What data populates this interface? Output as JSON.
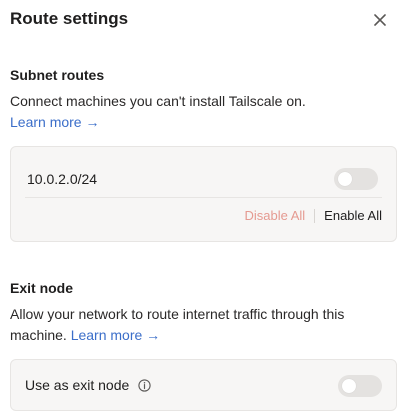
{
  "header": {
    "title": "Route settings",
    "close_icon": "close-icon"
  },
  "subnet": {
    "title": "Subnet routes",
    "description": "Connect machines you can't install Tailscale on.",
    "learn_more": "Learn more →",
    "routes": [
      {
        "cidr": "10.0.2.0/24",
        "enabled": false
      }
    ],
    "disable_all_label": "Disable All",
    "enable_all_label": "Enable All"
  },
  "exit_node": {
    "title": "Exit node",
    "description": "Allow your network to route internet traffic through this machine.",
    "learn_more": "Learn more →",
    "option_label": "Use as exit node",
    "info_icon": "info-icon",
    "enabled": false
  },
  "colors": {
    "link": "#3b6ec9",
    "danger_muted": "#e59a91",
    "card_bg": "#f7f6f5",
    "toggle_off": "#e4e2e0"
  }
}
